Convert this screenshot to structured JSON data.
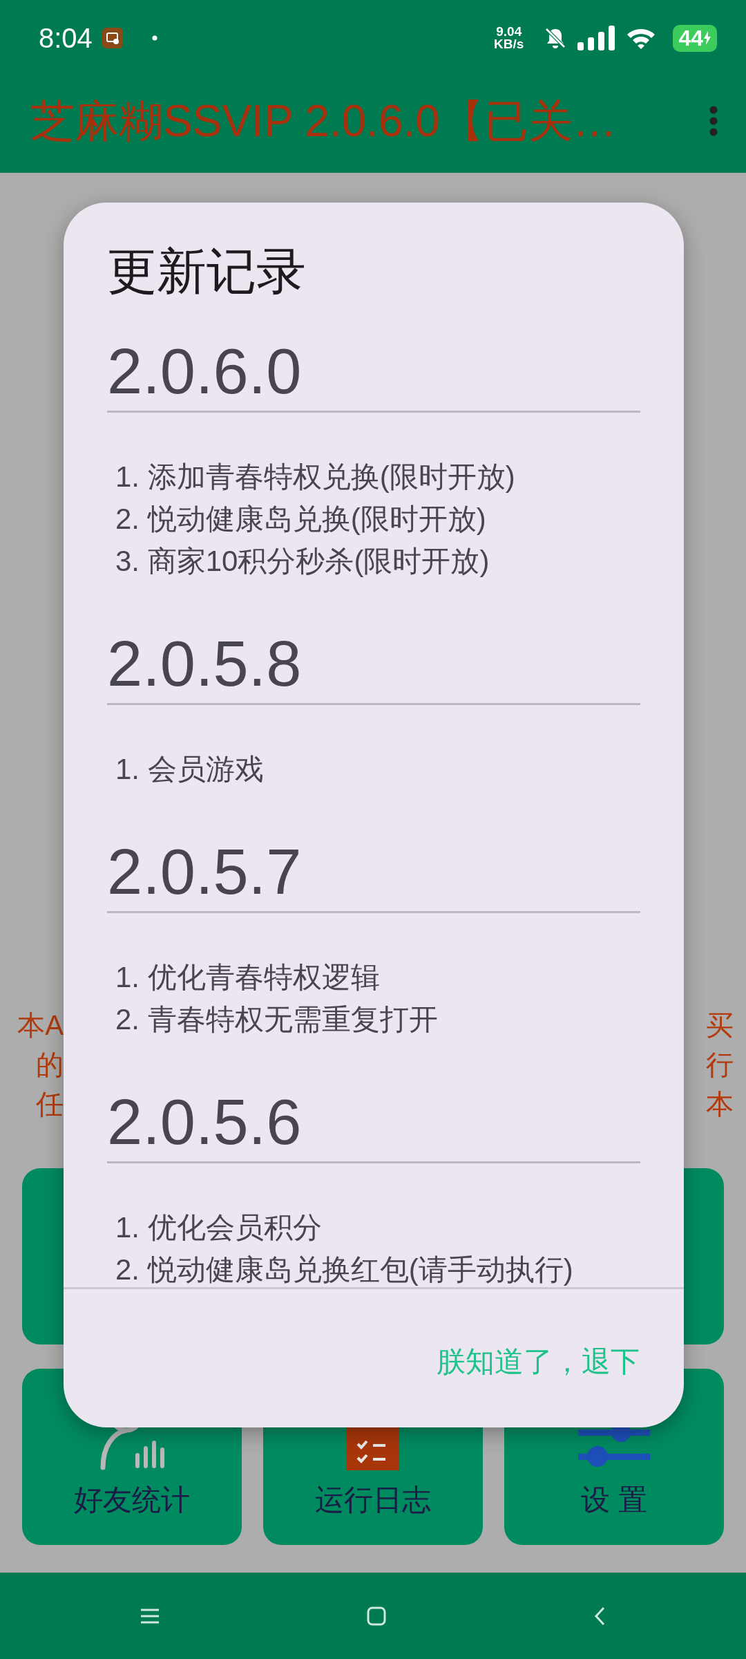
{
  "status_bar": {
    "time": "8:04",
    "net_speed": "9.04",
    "net_unit": "KB/s",
    "battery": "44"
  },
  "app_bar": {
    "title": "芝麻糊SSVIP 2.0.6.0【已关…"
  },
  "background_notice": {
    "left_lines": [
      "本A",
      "的",
      "任"
    ],
    "right_lines": [
      "买",
      "行",
      "本"
    ]
  },
  "top_cards": [
    {
      "kind": "blank"
    },
    {
      "kind": "blank"
    }
  ],
  "bottom_cards": [
    {
      "kind": "friends",
      "label": "好友统计"
    },
    {
      "kind": "log",
      "label": "运行日志"
    },
    {
      "kind": "settings",
      "label": "设 置"
    }
  ],
  "dialog": {
    "title": "更新记录",
    "versions": [
      {
        "version": "2.0.6.0",
        "changes": [
          "1. 添加青春特权兑换(限时开放)",
          "2. 悦动健康岛兑换(限时开放)",
          "3. 商家10积分秒杀(限时开放)"
        ]
      },
      {
        "version": "2.0.5.8",
        "changes": [
          "1. 会员游戏"
        ]
      },
      {
        "version": "2.0.5.7",
        "changes": [
          "1. 优化青春特权逻辑",
          "2. 青春特权无需重复打开"
        ]
      },
      {
        "version": "2.0.5.6",
        "changes": [
          "1. 优化会员积分",
          "2. 悦动健康岛兑换红包(请手动执行)"
        ]
      }
    ],
    "confirm_button": "朕知道了，退下"
  }
}
